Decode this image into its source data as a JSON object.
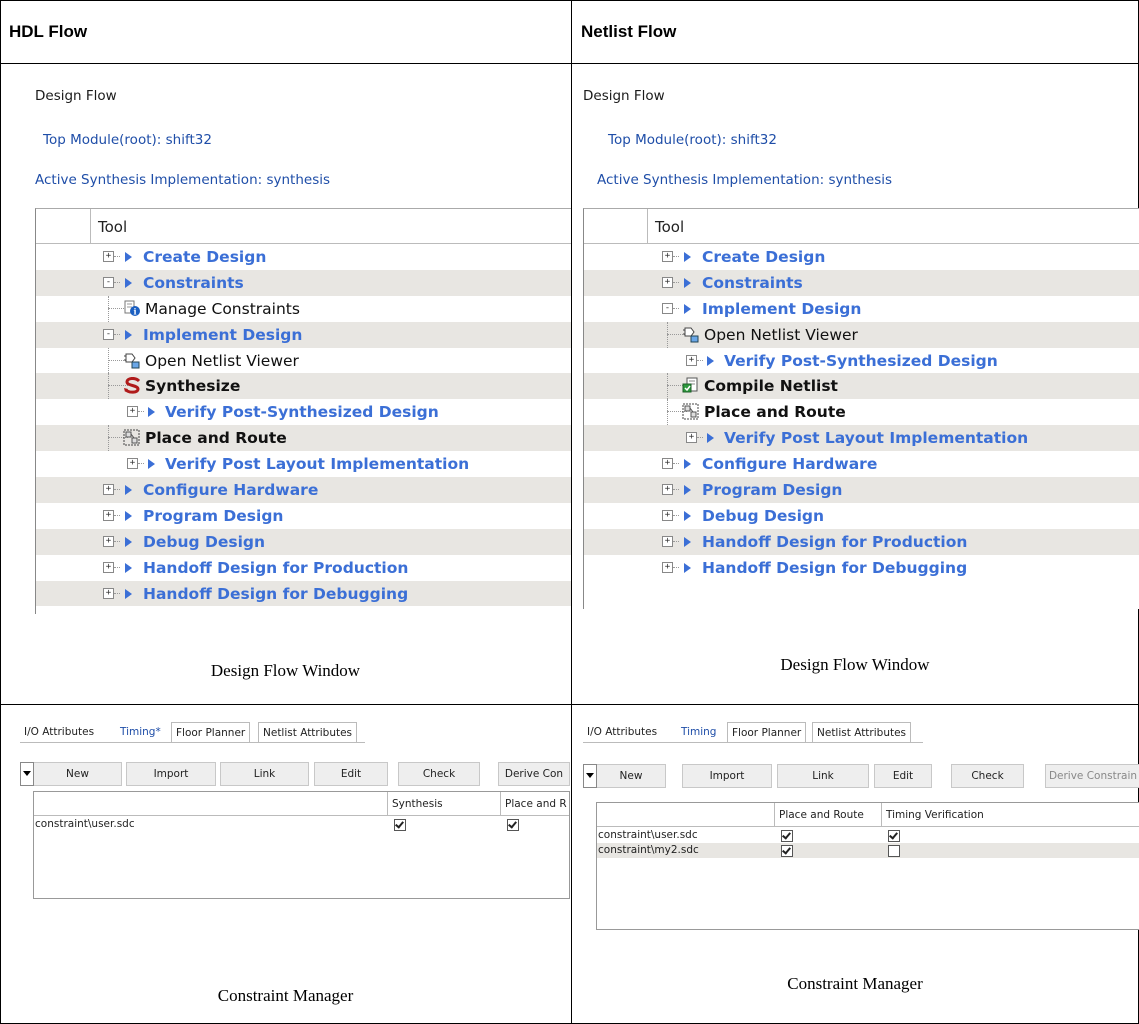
{
  "columns": {
    "hdl_title": "HDL Flow",
    "netlist_title": "Netlist Flow"
  },
  "design_flow": {
    "panel_label": "Design Flow",
    "top_module": "Top Module(root): shift32",
    "active_synthesis": "Active Synthesis Implementation: synthesis",
    "tool_header": "Tool"
  },
  "hdl_tree": [
    {
      "label": "Create Design",
      "kind": "category",
      "expander": "+"
    },
    {
      "label": "Constraints",
      "kind": "category",
      "expander": "−"
    },
    {
      "label": "Manage Constraints",
      "kind": "tool",
      "icon": "manage-constraints-icon"
    },
    {
      "label": "Implement Design",
      "kind": "category",
      "expander": "−"
    },
    {
      "label": "Open Netlist Viewer",
      "kind": "tool",
      "icon": "netlist-viewer-icon"
    },
    {
      "label": "Synthesize",
      "kind": "bold",
      "icon": "synthesize-icon"
    },
    {
      "label": "Verify Post-Synthesized Design",
      "kind": "subcategory",
      "expander": "+"
    },
    {
      "label": "Place and Route",
      "kind": "bold",
      "icon": "place-route-icon"
    },
    {
      "label": "Verify Post Layout Implementation",
      "kind": "subcategory",
      "expander": "+"
    },
    {
      "label": "Configure Hardware",
      "kind": "category",
      "expander": "+"
    },
    {
      "label": "Program Design",
      "kind": "category",
      "expander": "+"
    },
    {
      "label": "Debug Design",
      "kind": "category",
      "expander": "+"
    },
    {
      "label": "Handoff Design for Production",
      "kind": "category",
      "expander": "+"
    },
    {
      "label": "Handoff Design for Debugging",
      "kind": "category",
      "expander": "+"
    }
  ],
  "netlist_tree": [
    {
      "label": "Create Design",
      "kind": "category",
      "expander": "+"
    },
    {
      "label": "Constraints",
      "kind": "category",
      "expander": "+"
    },
    {
      "label": "Implement Design",
      "kind": "category",
      "expander": "−"
    },
    {
      "label": "Open Netlist Viewer",
      "kind": "tool",
      "icon": "netlist-viewer-icon"
    },
    {
      "label": "Verify Post-Synthesized Design",
      "kind": "subcategory",
      "expander": "+"
    },
    {
      "label": "Compile Netlist",
      "kind": "bold",
      "icon": "compile-netlist-icon"
    },
    {
      "label": "Place and Route",
      "kind": "bold",
      "icon": "place-route-icon"
    },
    {
      "label": "Verify Post Layout Implementation",
      "kind": "subcategory",
      "expander": "+"
    },
    {
      "label": "Configure Hardware",
      "kind": "category",
      "expander": "+"
    },
    {
      "label": "Program Design",
      "kind": "category",
      "expander": "+"
    },
    {
      "label": "Debug Design",
      "kind": "category",
      "expander": "+"
    },
    {
      "label": "Handoff Design for Production",
      "kind": "category",
      "expander": "+"
    },
    {
      "label": "Handoff Design for Debugging",
      "kind": "category",
      "expander": "+"
    }
  ],
  "captions": {
    "design_flow_window": "Design Flow Window",
    "constraint_manager": "Constraint Manager"
  },
  "cm_hdl": {
    "tabs": [
      "I/O Attributes",
      "Timing*",
      "Floor Planner",
      "Netlist Attributes"
    ],
    "buttons": [
      "New",
      "Import",
      "Link",
      "Edit",
      "Check",
      "Derive Con"
    ],
    "headers": [
      "",
      "Synthesis",
      "Place and R"
    ],
    "rows": [
      {
        "file": "constraint\\user.sdc",
        "checks": [
          true,
          true
        ]
      }
    ]
  },
  "cm_netlist": {
    "tabs": [
      "I/O Attributes",
      "Timing",
      "Floor Planner",
      "Netlist Attributes"
    ],
    "buttons": [
      "New",
      "Import",
      "Link",
      "Edit",
      "Check",
      "Derive Constrain"
    ],
    "headers": [
      "",
      "Place and Route",
      "Timing Verification"
    ],
    "rows": [
      {
        "file": "constraint\\user.sdc",
        "checks": [
          true,
          true
        ]
      },
      {
        "file": "constraint\\my2.sdc",
        "checks": [
          true,
          false
        ]
      }
    ]
  },
  "colors": {
    "category_blue": "#3b6fd6",
    "link_blue": "#1f4ea8",
    "row_shade": "#e8e6e2"
  }
}
